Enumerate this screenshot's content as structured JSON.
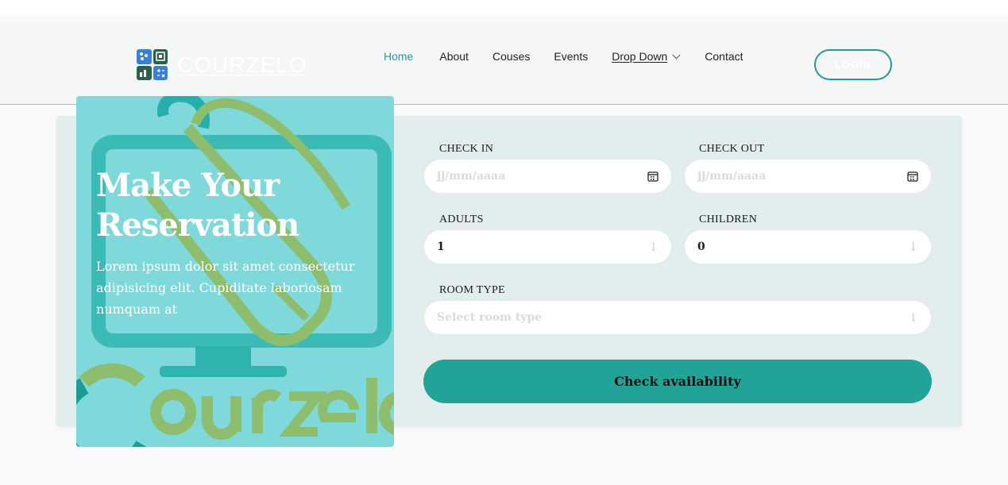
{
  "brand": {
    "name": "COURZELO",
    "watermark": "Courzelo"
  },
  "nav": {
    "items": [
      "Home",
      "About",
      "Couses",
      "Events",
      "Drop Down",
      "Contact"
    ],
    "login_label": "LOGIN"
  },
  "promo": {
    "title": "Make Your Reservation",
    "text": "Lorem ipsum dolor sit amet consectetur adipisicing elit. Cupiditate laboriosam numquam at"
  },
  "form": {
    "check_in": {
      "label": "CHECK IN",
      "placeholder": "jj/mm/aaaa"
    },
    "check_out": {
      "label": "CHECK OUT",
      "placeholder": "jj/mm/aaaa"
    },
    "adults": {
      "label": "ADULTS",
      "value": "1"
    },
    "children": {
      "label": "CHILDREN",
      "value": "0"
    },
    "room_type": {
      "label": "ROOM TYPE",
      "placeholder": "Select room type"
    },
    "submit_label": "Check availability"
  },
  "colors": {
    "accent": "#21a398",
    "nav_active": "#259996",
    "promo_bg": "#7fd8d9",
    "card_bg": "#e2eded"
  },
  "icons": {
    "logo": "courzelo-logo-icon",
    "date": "calendar-icon",
    "select": "arrow-down-icon",
    "dropdown": "chevron-down-icon"
  }
}
